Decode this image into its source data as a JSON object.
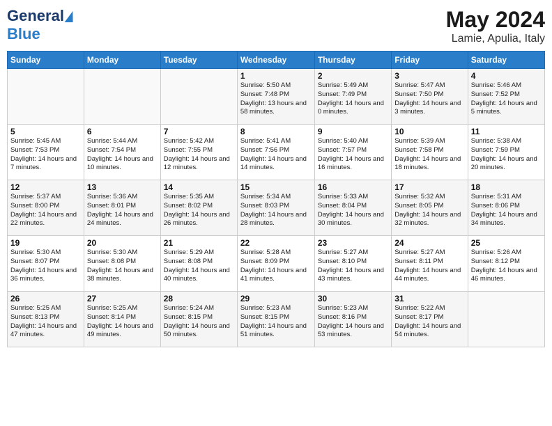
{
  "header": {
    "logo_line1": "General",
    "logo_line2": "Blue",
    "month": "May 2024",
    "location": "Lamie, Apulia, Italy"
  },
  "weekdays": [
    "Sunday",
    "Monday",
    "Tuesday",
    "Wednesday",
    "Thursday",
    "Friday",
    "Saturday"
  ],
  "weeks": [
    [
      {
        "day": "",
        "sunrise": "",
        "sunset": "",
        "daylight": ""
      },
      {
        "day": "",
        "sunrise": "",
        "sunset": "",
        "daylight": ""
      },
      {
        "day": "",
        "sunrise": "",
        "sunset": "",
        "daylight": ""
      },
      {
        "day": "1",
        "sunrise": "Sunrise: 5:50 AM",
        "sunset": "Sunset: 7:48 PM",
        "daylight": "Daylight: 13 hours and 58 minutes."
      },
      {
        "day": "2",
        "sunrise": "Sunrise: 5:49 AM",
        "sunset": "Sunset: 7:49 PM",
        "daylight": "Daylight: 14 hours and 0 minutes."
      },
      {
        "day": "3",
        "sunrise": "Sunrise: 5:47 AM",
        "sunset": "Sunset: 7:50 PM",
        "daylight": "Daylight: 14 hours and 3 minutes."
      },
      {
        "day": "4",
        "sunrise": "Sunrise: 5:46 AM",
        "sunset": "Sunset: 7:52 PM",
        "daylight": "Daylight: 14 hours and 5 minutes."
      }
    ],
    [
      {
        "day": "5",
        "sunrise": "Sunrise: 5:45 AM",
        "sunset": "Sunset: 7:53 PM",
        "daylight": "Daylight: 14 hours and 7 minutes."
      },
      {
        "day": "6",
        "sunrise": "Sunrise: 5:44 AM",
        "sunset": "Sunset: 7:54 PM",
        "daylight": "Daylight: 14 hours and 10 minutes."
      },
      {
        "day": "7",
        "sunrise": "Sunrise: 5:42 AM",
        "sunset": "Sunset: 7:55 PM",
        "daylight": "Daylight: 14 hours and 12 minutes."
      },
      {
        "day": "8",
        "sunrise": "Sunrise: 5:41 AM",
        "sunset": "Sunset: 7:56 PM",
        "daylight": "Daylight: 14 hours and 14 minutes."
      },
      {
        "day": "9",
        "sunrise": "Sunrise: 5:40 AM",
        "sunset": "Sunset: 7:57 PM",
        "daylight": "Daylight: 14 hours and 16 minutes."
      },
      {
        "day": "10",
        "sunrise": "Sunrise: 5:39 AM",
        "sunset": "Sunset: 7:58 PM",
        "daylight": "Daylight: 14 hours and 18 minutes."
      },
      {
        "day": "11",
        "sunrise": "Sunrise: 5:38 AM",
        "sunset": "Sunset: 7:59 PM",
        "daylight": "Daylight: 14 hours and 20 minutes."
      }
    ],
    [
      {
        "day": "12",
        "sunrise": "Sunrise: 5:37 AM",
        "sunset": "Sunset: 8:00 PM",
        "daylight": "Daylight: 14 hours and 22 minutes."
      },
      {
        "day": "13",
        "sunrise": "Sunrise: 5:36 AM",
        "sunset": "Sunset: 8:01 PM",
        "daylight": "Daylight: 14 hours and 24 minutes."
      },
      {
        "day": "14",
        "sunrise": "Sunrise: 5:35 AM",
        "sunset": "Sunset: 8:02 PM",
        "daylight": "Daylight: 14 hours and 26 minutes."
      },
      {
        "day": "15",
        "sunrise": "Sunrise: 5:34 AM",
        "sunset": "Sunset: 8:03 PM",
        "daylight": "Daylight: 14 hours and 28 minutes."
      },
      {
        "day": "16",
        "sunrise": "Sunrise: 5:33 AM",
        "sunset": "Sunset: 8:04 PM",
        "daylight": "Daylight: 14 hours and 30 minutes."
      },
      {
        "day": "17",
        "sunrise": "Sunrise: 5:32 AM",
        "sunset": "Sunset: 8:05 PM",
        "daylight": "Daylight: 14 hours and 32 minutes."
      },
      {
        "day": "18",
        "sunrise": "Sunrise: 5:31 AM",
        "sunset": "Sunset: 8:06 PM",
        "daylight": "Daylight: 14 hours and 34 minutes."
      }
    ],
    [
      {
        "day": "19",
        "sunrise": "Sunrise: 5:30 AM",
        "sunset": "Sunset: 8:07 PM",
        "daylight": "Daylight: 14 hours and 36 minutes."
      },
      {
        "day": "20",
        "sunrise": "Sunrise: 5:30 AM",
        "sunset": "Sunset: 8:08 PM",
        "daylight": "Daylight: 14 hours and 38 minutes."
      },
      {
        "day": "21",
        "sunrise": "Sunrise: 5:29 AM",
        "sunset": "Sunset: 8:08 PM",
        "daylight": "Daylight: 14 hours and 40 minutes."
      },
      {
        "day": "22",
        "sunrise": "Sunrise: 5:28 AM",
        "sunset": "Sunset: 8:09 PM",
        "daylight": "Daylight: 14 hours and 41 minutes."
      },
      {
        "day": "23",
        "sunrise": "Sunrise: 5:27 AM",
        "sunset": "Sunset: 8:10 PM",
        "daylight": "Daylight: 14 hours and 43 minutes."
      },
      {
        "day": "24",
        "sunrise": "Sunrise: 5:27 AM",
        "sunset": "Sunset: 8:11 PM",
        "daylight": "Daylight: 14 hours and 44 minutes."
      },
      {
        "day": "25",
        "sunrise": "Sunrise: 5:26 AM",
        "sunset": "Sunset: 8:12 PM",
        "daylight": "Daylight: 14 hours and 46 minutes."
      }
    ],
    [
      {
        "day": "26",
        "sunrise": "Sunrise: 5:25 AM",
        "sunset": "Sunset: 8:13 PM",
        "daylight": "Daylight: 14 hours and 47 minutes."
      },
      {
        "day": "27",
        "sunrise": "Sunrise: 5:25 AM",
        "sunset": "Sunset: 8:14 PM",
        "daylight": "Daylight: 14 hours and 49 minutes."
      },
      {
        "day": "28",
        "sunrise": "Sunrise: 5:24 AM",
        "sunset": "Sunset: 8:15 PM",
        "daylight": "Daylight: 14 hours and 50 minutes."
      },
      {
        "day": "29",
        "sunrise": "Sunrise: 5:23 AM",
        "sunset": "Sunset: 8:15 PM",
        "daylight": "Daylight: 14 hours and 51 minutes."
      },
      {
        "day": "30",
        "sunrise": "Sunrise: 5:23 AM",
        "sunset": "Sunset: 8:16 PM",
        "daylight": "Daylight: 14 hours and 53 minutes."
      },
      {
        "day": "31",
        "sunrise": "Sunrise: 5:22 AM",
        "sunset": "Sunset: 8:17 PM",
        "daylight": "Daylight: 14 hours and 54 minutes."
      },
      {
        "day": "",
        "sunrise": "",
        "sunset": "",
        "daylight": ""
      }
    ]
  ]
}
